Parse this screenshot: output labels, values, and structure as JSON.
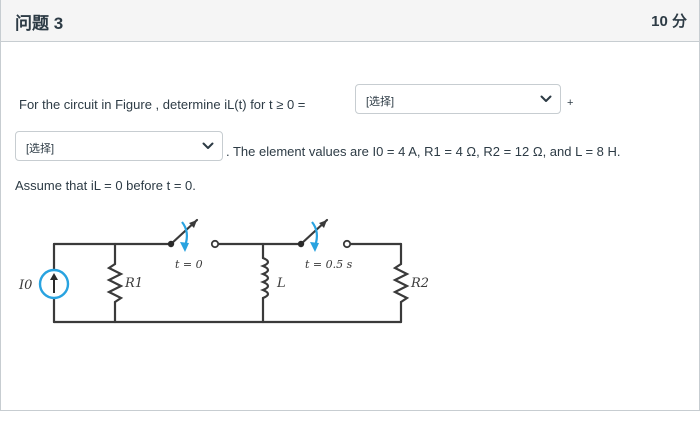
{
  "question": {
    "title": "问题 3",
    "points": "10 分"
  },
  "body": {
    "line1_prefix": "For the circuit in Figure , determine iL(t) for t ≥ 0 =",
    "plus": "+",
    "line2_suffix": ". The element values are I0 = 4 A, R1 = 4 Ω, R2 = 12 Ω, and L = 8 H.",
    "line3": "Assume that iL = 0 before t = 0."
  },
  "dropdowns": [
    {
      "value": "[选择]"
    },
    {
      "value": "[选择]"
    }
  ],
  "figure": {
    "source_label": "I0",
    "r1_label": "R1",
    "l_label": "L",
    "r2_label": "R2",
    "switch1_label": "t = 0",
    "switch2_label": "t = 0.5 s"
  },
  "colors": {
    "arrow_blue": "#29a3e0",
    "text": "#2d3b45",
    "border": "#c7cdd1",
    "header_bg": "#f5f5f5"
  }
}
